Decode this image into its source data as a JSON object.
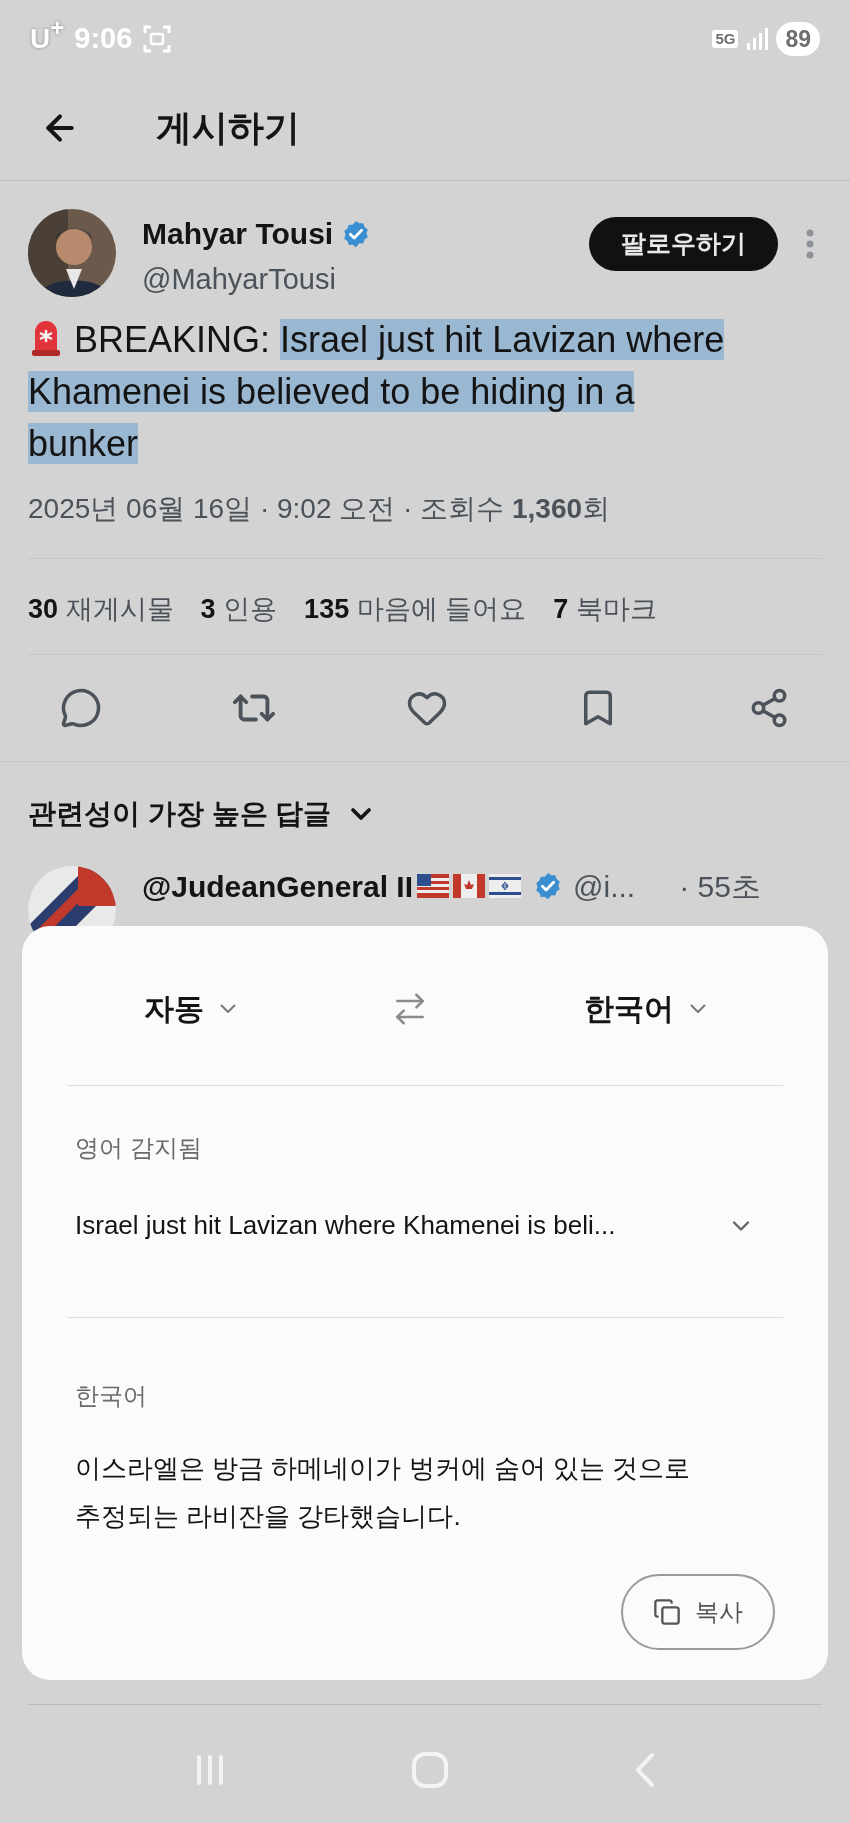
{
  "status_bar": {
    "carrier": "U$^{+}$",
    "time": "9:06",
    "network": "5G",
    "battery": "89"
  },
  "header": {
    "title": "게시하기"
  },
  "post": {
    "author": {
      "name": "Mahyar Tousi",
      "handle": "@MahyarTousi",
      "verified": true
    },
    "follow_button": "팔로우하기",
    "text_lead": "BREAKING:",
    "text_selected": "Israel just hit Lavizan where Khamenei is believed to be hiding in a bunker",
    "meta": "2025년 06월 16일 · 9:02 오전 · 조회수 **1,360**회",
    "stats": [
      {
        "count": "30",
        "label": "재게시물"
      },
      {
        "count": "3",
        "label": "인용"
      },
      {
        "count": "135",
        "label": "마음에 들어요"
      },
      {
        "count": "7",
        "label": "북마크"
      }
    ]
  },
  "replies": {
    "sort_label": "관련성이 가장 높은 답글",
    "first_reply": {
      "name": "@JudeanGeneral II",
      "verified": true,
      "handle": "@i...",
      "time": "· 55초"
    }
  },
  "translator": {
    "source_language": "자동",
    "target_language": "한국어",
    "detected_label": "영어 감지됨",
    "source_text": "Israel just hit Lavizan where Khamenei is beli...",
    "result_label": "한국어",
    "result_text": "이스라엘은 방금 하메네이가 벙커에 숨어 있는 것으로 추정되는 라비잔을 강타했습니다.",
    "copy_button": "복사"
  }
}
